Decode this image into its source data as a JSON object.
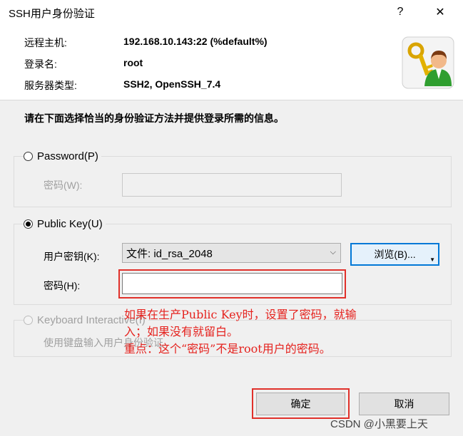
{
  "window": {
    "title": "SSH用户身份验证",
    "help_glyph": "?",
    "close_glyph": "✕"
  },
  "header": {
    "remote_host_label": "远程主机:",
    "remote_host_value": "192.168.10.143:22 (%default%)",
    "login_label": "登录名:",
    "login_value": "root",
    "server_type_label": "服务器类型:",
    "server_type_value": "SSH2, OpenSSH_7.4",
    "avatar_icon": "user-key-icon"
  },
  "instruction": "请在下面选择恰当的身份验证方法并提供登录所需的信息。",
  "password_group": {
    "radio_label": "Password(P)",
    "selected": false,
    "field_label": "密码(W):",
    "field_value": ""
  },
  "publickey_group": {
    "radio_label": "Public Key(U)",
    "selected": true,
    "key_label": "用户密钥(K):",
    "key_value": "文件: id_rsa_2048",
    "browse_label": "浏览(B)...",
    "passphrase_label": "密码(H):",
    "passphrase_value": ""
  },
  "keyboard_group": {
    "radio_label": "Keyboard Interactive(I)",
    "selected": false,
    "description": "使用键盘输入用户身份验证"
  },
  "annotation": {
    "line1": "如果在生产Public Key时，设置了密码，就输",
    "line2": "入；如果没有就留白。",
    "line3": "重点：这个“密码”不是root用户的密码。",
    "color": "#e5221e"
  },
  "buttons": {
    "ok_label": "确定",
    "cancel_label": "取消"
  },
  "watermark": "CSDN @小黑要上天"
}
